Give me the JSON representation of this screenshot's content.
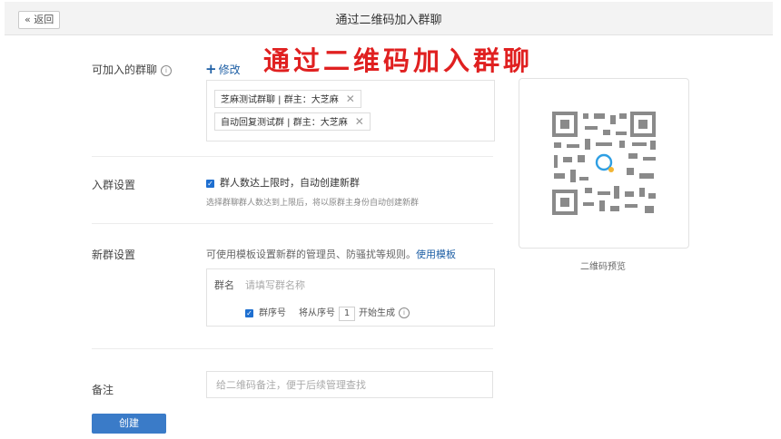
{
  "header": {
    "back_label": "« 返回",
    "title": "通过二维码加入群聊"
  },
  "watermark": "通过二维码加入群聊",
  "joinable_groups": {
    "label": "可加入的群聊",
    "edit_label": "修改",
    "tags": [
      {
        "text": "芝麻测试群聊 | 群主：大芝麻"
      },
      {
        "text": "自动回复测试群 | 群主：大芝麻"
      }
    ]
  },
  "join_settings": {
    "label": "入群设置",
    "checkbox_label": "群人数达上限时，自动创建新群",
    "hint": "选择群聊群人数达到上限后，将以原群主身份自动创建新群"
  },
  "new_group_settings": {
    "label": "新群设置",
    "description": "可使用模板设置新群的管理员、防骚扰等规则。",
    "template_link": "使用模板",
    "name_label": "群名",
    "name_placeholder": "请填写群名称",
    "serial_checkbox_label": "群序号",
    "serial_prefix": "将从序号",
    "serial_start": "1",
    "serial_suffix": "开始生成"
  },
  "remark": {
    "label": "备注",
    "placeholder": "给二维码备注，便于后续管理查找"
  },
  "create_button": "创建",
  "qr": {
    "caption": "二维码预览",
    "logo_icon": "chat-bubble-icon"
  },
  "colors": {
    "accent": "#1e5fa5",
    "primary_button": "#3a7bc8",
    "watermark": "#e02020"
  }
}
